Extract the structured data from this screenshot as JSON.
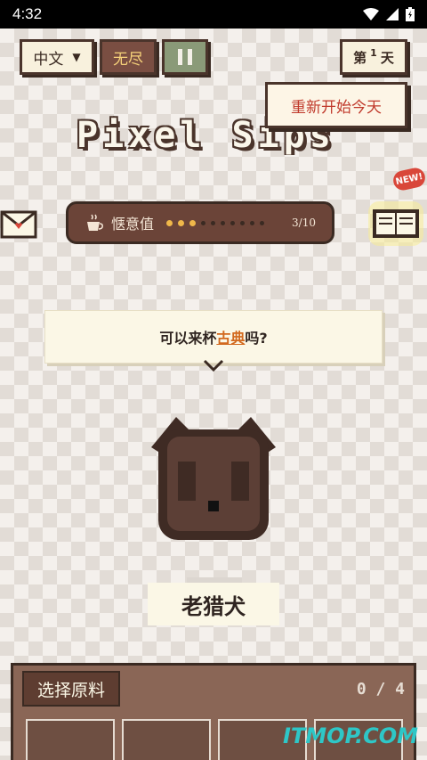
{
  "status_bar": {
    "time": "4:32"
  },
  "toolbar": {
    "language_label": "中文",
    "mode_label": "无尽",
    "day_prefix": "第",
    "day_number": "1",
    "day_suffix": "天"
  },
  "restart_popup": {
    "label": "重新开始今天"
  },
  "title": "Pixel Sips",
  "meter": {
    "label": "惬意值",
    "value": 3,
    "max": 10,
    "count_text": "3/10"
  },
  "new_badge": "NEW!",
  "dialog": {
    "prefix": "可以来杯",
    "highlight": "古典",
    "suffix": "吗?"
  },
  "customer": {
    "name": "老猎犬"
  },
  "ingredients": {
    "button_label": "选择原料",
    "count_text": "0 / 4",
    "slots": 4
  },
  "watermark": "ITMOP.COM",
  "colors": {
    "panel_brown": "#8a6656",
    "meter_on": "#f0b84a",
    "restart_text": "#c0392b",
    "highlight": "#d2691e"
  }
}
